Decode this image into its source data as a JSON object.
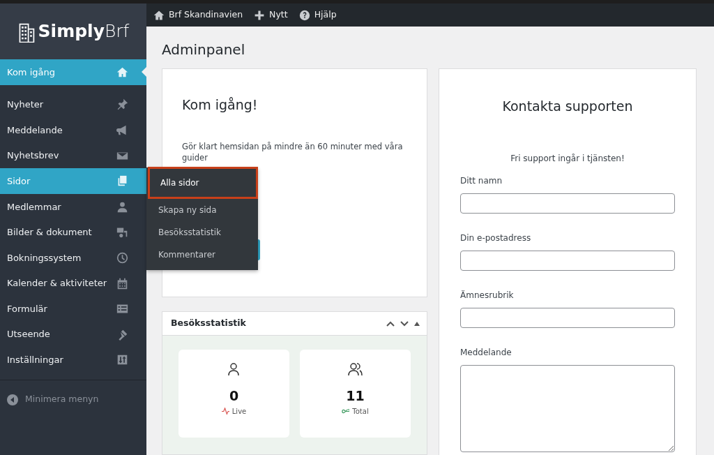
{
  "logo": {
    "text_bold": "Simply",
    "text_light": "Brf"
  },
  "topbar": [
    {
      "label": "Brf Skandinavien"
    },
    {
      "label": "Nytt"
    },
    {
      "label": "Hjälp"
    }
  ],
  "sidebar": {
    "items": [
      {
        "label": "Kom igång",
        "selected": true
      },
      {
        "label": "Nyheter",
        "selected": false
      },
      {
        "label": "Meddelande",
        "selected": false
      },
      {
        "label": "Nyhetsbrev",
        "selected": false
      },
      {
        "label": "Sidor",
        "selected": true,
        "submenu": [
          {
            "label": "Alla sidor",
            "selected": true,
            "highlighted": true
          },
          {
            "label": "Skapa ny sida",
            "selected": false,
            "highlighted": false
          },
          {
            "label": "Besöksstatistik",
            "selected": false,
            "highlighted": false
          },
          {
            "label": "Kommentarer",
            "selected": false,
            "highlighted": false
          }
        ]
      },
      {
        "label": "Medlemmar",
        "selected": false
      },
      {
        "label": "Bilder & dokument",
        "selected": false
      },
      {
        "label": "Bokningssystem",
        "selected": false
      },
      {
        "label": "Kalender & aktiviteter",
        "selected": false
      },
      {
        "label": "Formulär",
        "selected": false
      },
      {
        "label": "Utseende",
        "selected": false
      },
      {
        "label": "Inställningar",
        "selected": false
      }
    ],
    "collapse": "Minimera menyn"
  },
  "page_title": "Adminpanel",
  "getting_started": {
    "title": "Kom igång!",
    "text": "Gör klart hemsidan på mindre än 60 minuter med våra guider"
  },
  "stats": {
    "title": "Besöksstatistik",
    "cards": [
      {
        "value": "0",
        "label": "Live",
        "color": "#d9534f"
      },
      {
        "value": "11",
        "label": "Total",
        "color": "#3c9a5f"
      }
    ]
  },
  "support": {
    "title": "Kontakta supporten",
    "subtitle": "Fri support ingår i tjänsten!",
    "fields": [
      {
        "label": "Ditt namn",
        "kind": "input"
      },
      {
        "label": "Din e-postadress",
        "kind": "input"
      },
      {
        "label": "Ämnesrubrik",
        "kind": "input"
      },
      {
        "label": "Meddelande",
        "kind": "textarea"
      }
    ]
  }
}
